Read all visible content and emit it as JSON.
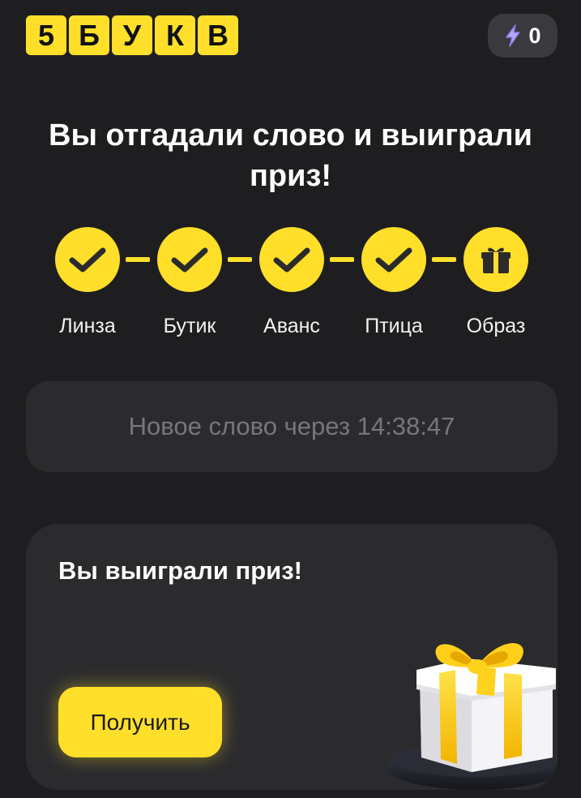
{
  "logo": {
    "letters": [
      "5",
      "Б",
      "У",
      "К",
      "В"
    ]
  },
  "energy": {
    "count": "0",
    "icon": "lightning-icon"
  },
  "headline": "Вы отгадали слово и выиграли приз!",
  "steps": [
    {
      "label": "Линза",
      "status": "done",
      "icon": "check-icon"
    },
    {
      "label": "Бутик",
      "status": "done",
      "icon": "check-icon"
    },
    {
      "label": "Аванс",
      "status": "done",
      "icon": "check-icon"
    },
    {
      "label": "Птица",
      "status": "done",
      "icon": "check-icon"
    },
    {
      "label": "Образ",
      "status": "prize",
      "icon": "gift-icon"
    }
  ],
  "timer": {
    "text": "Новое слово через 14:38:47"
  },
  "prize": {
    "title": "Вы выиграли приз!",
    "button_label": "Получить",
    "illustration": "gift-box-illustration"
  },
  "colors": {
    "background": "#1e1e20",
    "card": "#2b2b2e",
    "accent": "#ffdf2a",
    "muted_text": "#77777b",
    "bolt": "#b9a7f7"
  }
}
